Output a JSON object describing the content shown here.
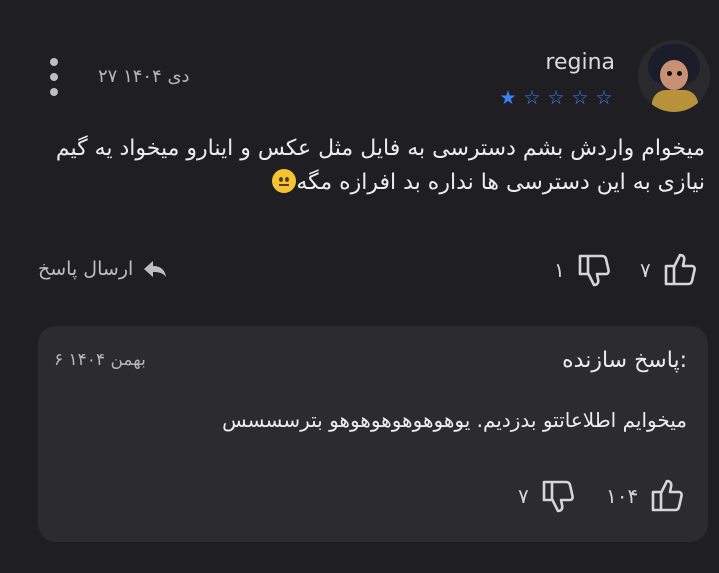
{
  "review": {
    "username": "regina",
    "rating": 1,
    "rating_max": 5,
    "date": "۲۷ دی ۱۴۰۴",
    "text": "میخوام واردش بشم دسترسی به فایل مثل عکس و اینارو میخواد یه گیم نیازی به این دسترسی ها نداره بد افرازه مگه",
    "emoji": "neutral-face-emoji",
    "reply_label": "ارسال پاسخ",
    "likes": "۷",
    "dislikes": "۱"
  },
  "developer_reply": {
    "title": "پاسخ سازنده:",
    "date": "۶ بهمن ۱۴۰۴",
    "text": "میخوایم اطلاعاتتو بدزدیم. یوهوهوهوهوهوهو بترسسسس",
    "likes": "۱۰۴",
    "dislikes": "۷"
  },
  "colors": {
    "background": "#1f1f23",
    "card": "#2b2b30",
    "star": "#3b82f6",
    "text": "#ececf0"
  }
}
